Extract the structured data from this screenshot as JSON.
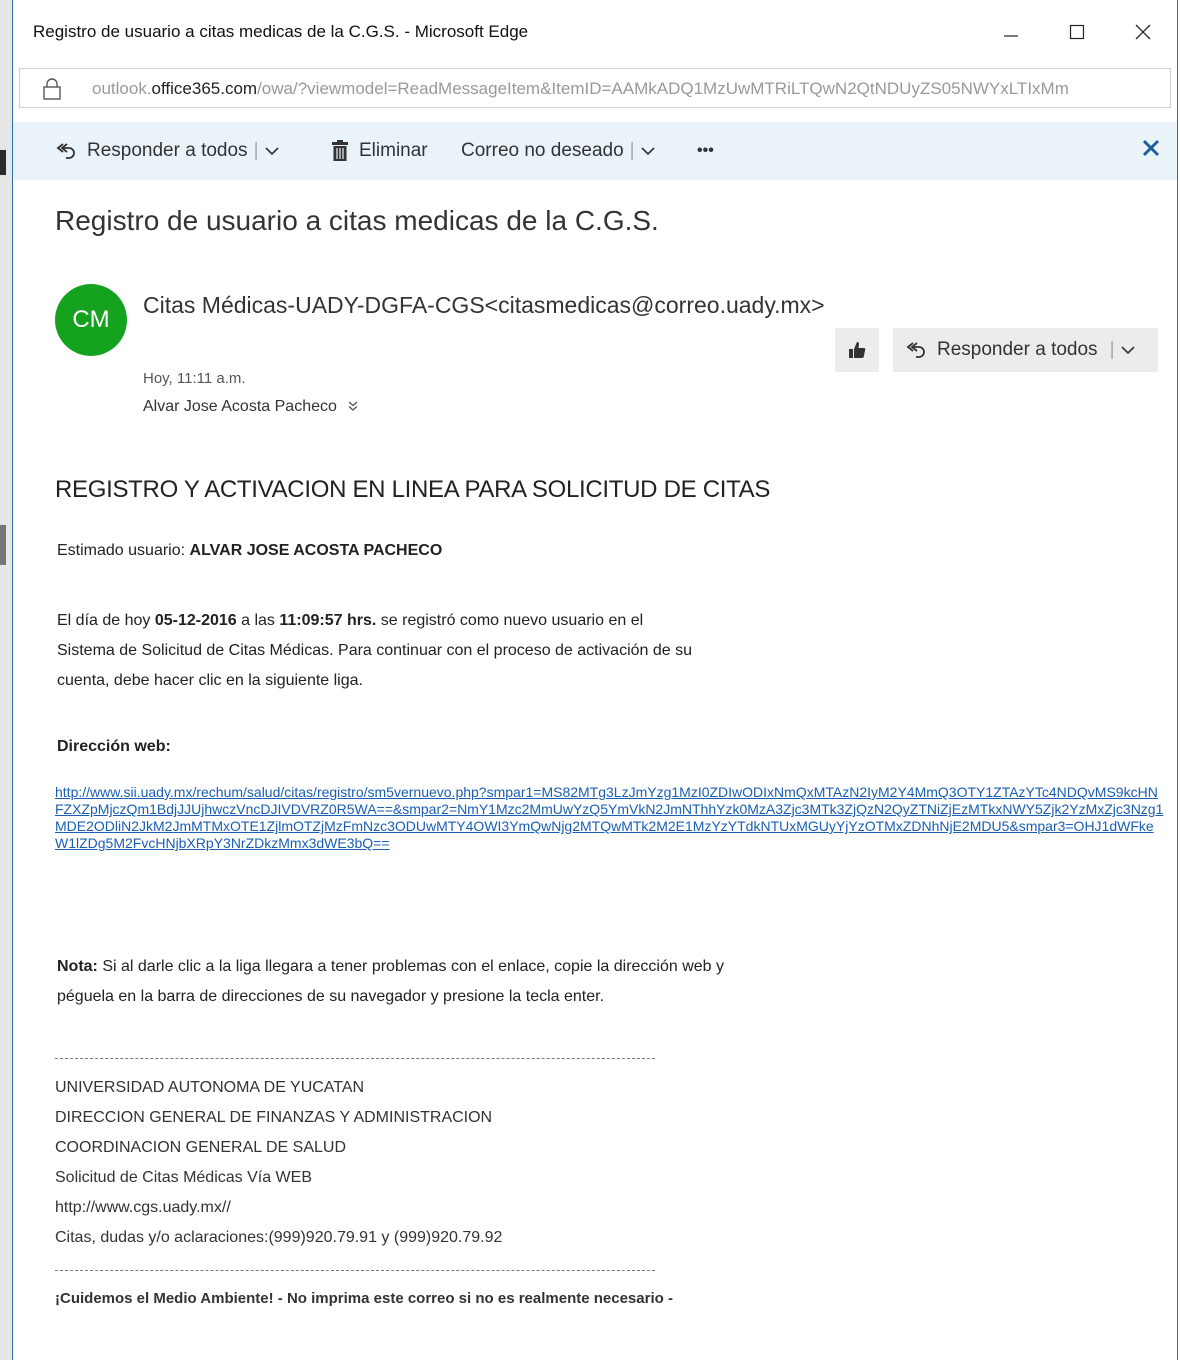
{
  "window": {
    "title": "Registro de usuario a citas medicas de la C.G.S. - Microsoft Edge"
  },
  "address": {
    "url_prefix": "outlook.",
    "url_domain": "office365.com",
    "url_rest": "/owa/?viewmodel=ReadMessageItem&ItemID=AAMkADQ1MzUwMTRiLTQwN2QtNDUyZS05NWYxLTIxMm"
  },
  "toolbar": {
    "reply_all": "Responder a todos",
    "delete": "Eliminar",
    "junk": "Correo no deseado",
    "more": "•••"
  },
  "message": {
    "subject": "Registro de usuario a citas medicas de la C.G.S.",
    "avatar_initials": "CM",
    "avatar_color": "#15a21e",
    "sender": "Citas Médicas-UADY-DGFA-CGS<citasmedicas@correo.uady.mx>",
    "reply_all": "Responder a todos",
    "date": "Hoy, 11:11 a.m.",
    "recipient": "Alvar Jose Acosta Pacheco"
  },
  "body": {
    "heading": "REGISTRO Y ACTIVACION EN LINEA PARA SOLICITUD DE CITAS",
    "greeting_prefix": "Estimado usuario: ",
    "greeting_name": "ALVAR JOSE ACOSTA PACHECO",
    "p1_a": "El día de hoy ",
    "p1_date": "05-12-2016",
    "p1_b": " a las ",
    "p1_time": "11:09:57 hrs.",
    "p1_c": " se registró como nuevo usuario en el",
    "p1_line2": "Sistema de Solicitud de Citas Médicas. Para continuar con el proceso de activación de su",
    "p1_line3": "cuenta, debe hacer clic en la siguiente liga.",
    "web_label": "Dirección web:",
    "link": "http://www.sii.uady.mx/rechum/salud/citas/registro/sm5vernuevo.php?smpar1=MS82MTg3LzJmYzg1MzI0ZDIwODIxNmQxMTAzN2IyM2Y4MmQ3OTY1ZTAzYTc4NDQvMS9kcHNFZXZpMjczQm1BdjJJUjhwczVncDJIVDVRZ0R5WA==&smpar2=NmY1Mzc2MmUwYzQ5YmVkN2JmNThhYzk0MzA3Zjc3MTk3ZjQzN2QyZTNiZjEzMTkxNWY5Zjk2YzMxZjc3Nzg1MDE2ODliN2JkM2JmMTMxOTE1ZjlmOTZjMzFmNzc3ODUwMTY4OWI3YmQwNjg2MTQwMTk2M2E1MzYzYTdkNTUxMGUyYjYzOTMxZDNhNjE2MDU5&smpar3=OHJ1dWFkeW1lZDg5M2FvcHNjbXRpY3NrZDkzMmx3dWE3bQ==",
    "note_label": "Nota:",
    "note_a": " Si al darle clic a la liga llegara a tener problemas con el enlace, copie la dirección web y",
    "note_b": "péguela en la barra de direcciones de su navegador y presione la tecla enter.",
    "footer_lines": [
      "UNIVERSIDAD AUTONOMA DE YUCATAN",
      "DIRECCION GENERAL DE FINANZAS Y ADMINISTRACION",
      "COORDINACION GENERAL DE SALUD",
      "Solicitud de Citas Médicas Vía WEB",
      "http://www.cgs.uady.mx//",
      "Citas, dudas y/o aclaraciones:(999)920.79.91 y (999)920.79.92"
    ],
    "eco_note": "¡Cuidemos el Medio Ambiente! - No imprima este correo si no es realmente necesario -"
  }
}
